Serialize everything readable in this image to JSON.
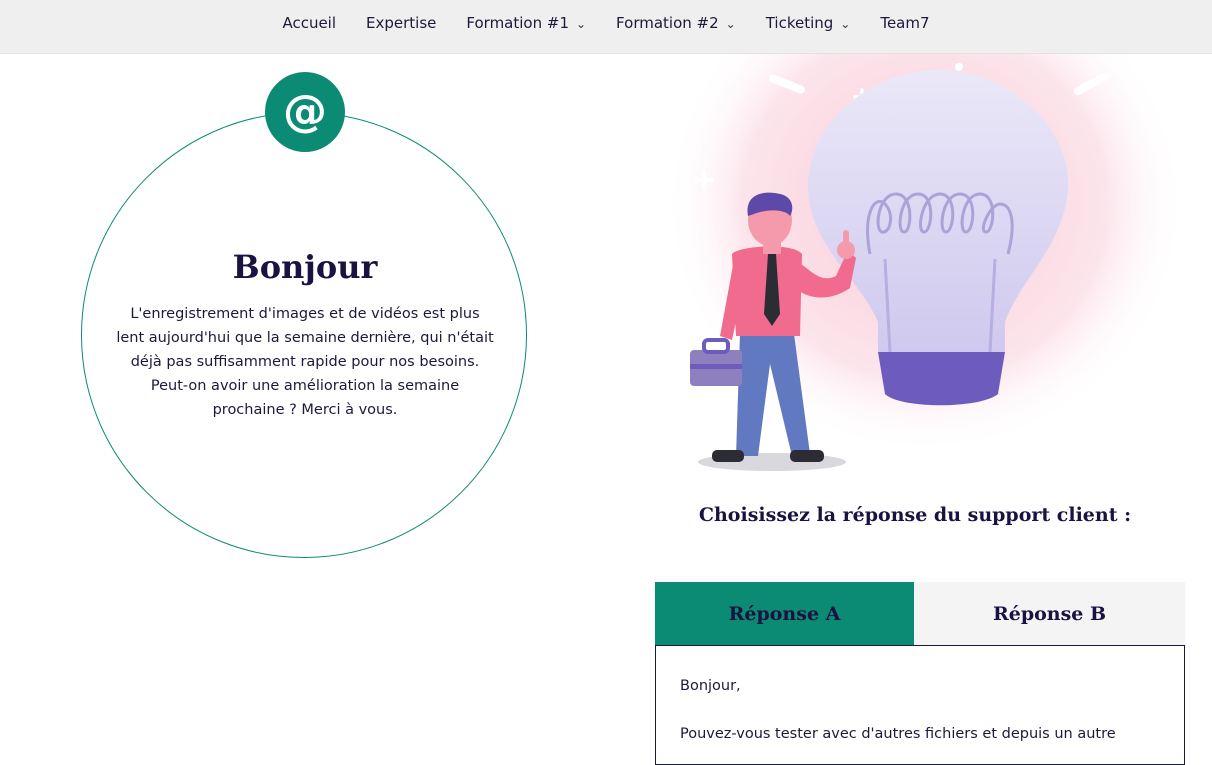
{
  "nav": {
    "items": [
      {
        "label": "Accueil",
        "dropdown": false
      },
      {
        "label": "Expertise",
        "dropdown": false
      },
      {
        "label": "Formation #1",
        "dropdown": true
      },
      {
        "label": "Formation #2",
        "dropdown": true
      },
      {
        "label": "Ticketing",
        "dropdown": true
      },
      {
        "label": "Team7",
        "dropdown": false
      }
    ],
    "chevron_icon": "chevron-down-icon"
  },
  "card": {
    "badge": "@",
    "title": "Bonjour",
    "text": "L'enregistrement d'images et de vidéos est plus lent aujourd'hui que la semaine dernière, qui n'était déjà pas suffisamment rapide pour nos besoins. Peut-on avoir une amélioration la semaine prochaine ? Merci à vous."
  },
  "support": {
    "heading": "Choisissez la réponse du support client :",
    "tabs": [
      {
        "label": "Réponse A",
        "active": true
      },
      {
        "label": "Réponse B",
        "active": false
      }
    ],
    "panel": {
      "greeting": "Bonjour,",
      "line1": "Pouvez-vous tester avec d'autres fichiers et depuis un autre"
    }
  },
  "colors": {
    "accent": "#0b8a74",
    "heading": "#1a1240",
    "nav_bg": "#efefef",
    "tab_inactive": "#f4f4f4"
  }
}
